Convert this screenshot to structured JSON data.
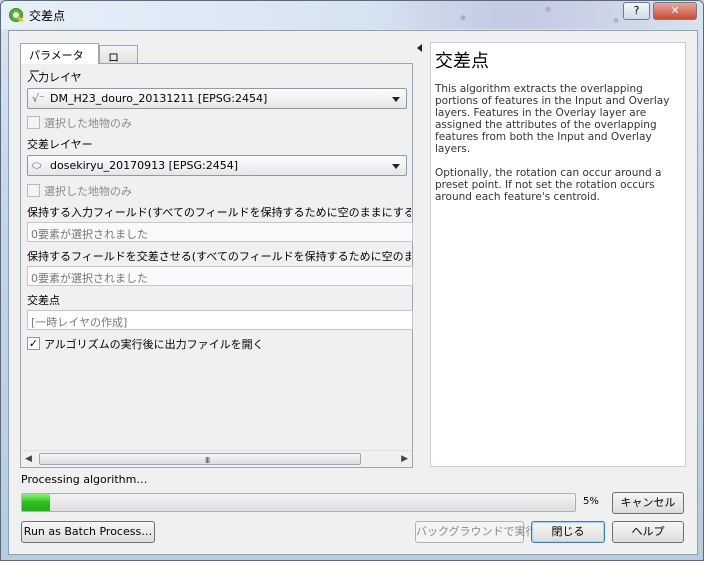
{
  "window": {
    "title": "交差点",
    "help_button": "?",
    "close_button": "✕"
  },
  "tabs": {
    "parameters": "パラメーター",
    "log": "ログ"
  },
  "params": {
    "input_layer_label": "入力レイヤ",
    "input_layer_value": "DM_H23_douro_20131211 [EPSG:2454]",
    "input_selected_only": "選択した地物のみ",
    "overlay_layer_label": "交差レイヤー",
    "overlay_layer_value": "dosekiryu_20170913 [EPSG:2454]",
    "overlay_selected_only": "選択した地物のみ",
    "input_fields_label": "保持する入力フィールド(すべてのフィールドを保持するために空のままにする) [optic",
    "input_fields_value": "0要素が選択されました",
    "overlay_fields_label": "保持するフィールドを交差させる(すべてのフィールドを保持するために空のままにする",
    "overlay_fields_value": "0要素が選択されました",
    "output_label": "交差点",
    "output_placeholder": "[一時レイヤの作成]",
    "open_output_label": "アルゴリズムの実行後に出力ファイルを開く",
    "open_output_checked": true
  },
  "help": {
    "title": "交差点",
    "paragraph1": "This algorithm extracts the overlapping portions of features in the Input and Overlay layers. Features in the Overlay layer are assigned the attributes of the overlapping features from both the Input and Overlay layers.",
    "paragraph2": "Optionally, the rotation can occur around a preset point. If not set the rotation occurs around each feature's centroid."
  },
  "progress": {
    "label": "Processing algorithm…",
    "percent": 5,
    "percent_text": "5%"
  },
  "buttons": {
    "cancel": "キャンセル",
    "batch": "Run as Batch Process…",
    "background": "バックグラウンドで実行",
    "close": "閉じる",
    "help": "ヘルプ"
  },
  "scrollbar": {
    "grip": "III"
  }
}
